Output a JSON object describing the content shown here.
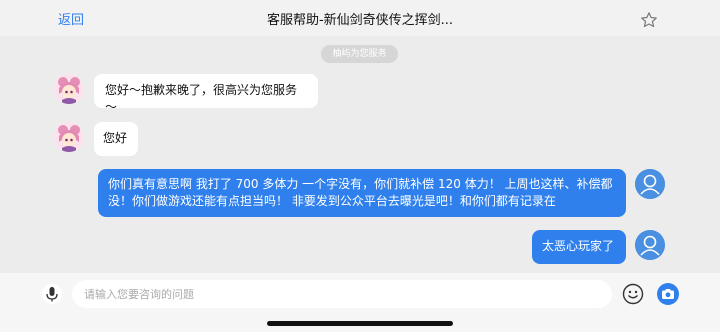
{
  "header": {
    "back_label": "返回",
    "title": "客服帮助-新仙剑奇侠传之挥剑...",
    "favorite_icon": "star-outline-icon"
  },
  "system_notice": "柚屿为您服务",
  "messages": [
    {
      "sender": "agent",
      "text": "您好～抱歉来晚了，很高兴为您服务～"
    },
    {
      "sender": "agent",
      "text": "您好"
    },
    {
      "sender": "user",
      "line1": "你们真有意思啊 我打了 700 多体力 一个字没有，你们就补偿 120 体力！ 上周也这样、补偿都",
      "line2": "没！你们做游戏还能有点担当吗！ 非要发到公众平台去曝光是吧！和你们都有记录在"
    },
    {
      "sender": "user",
      "text": "太恶心玩家了"
    }
  ],
  "composer": {
    "placeholder": "请输入您要咨询的问题",
    "mic_icon": "microphone-icon",
    "emoji_icon": "emoji-icon",
    "camera_icon": "camera-icon"
  },
  "colors": {
    "accent": "#2f80ed",
    "user_bubble": "#2f80ed",
    "agent_bubble": "#ffffff",
    "background": "#ececec"
  }
}
